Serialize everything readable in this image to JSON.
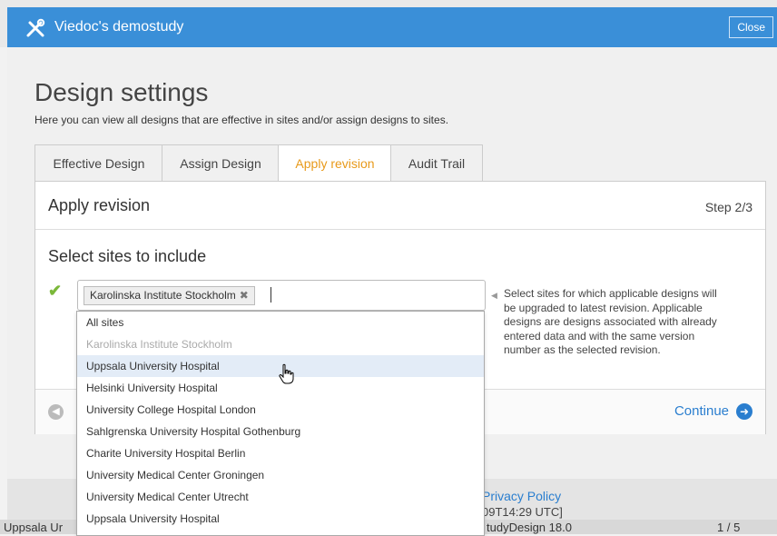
{
  "header": {
    "app_title": "Viedoc's demostudy",
    "close_label": "Close"
  },
  "page": {
    "title": "Design settings",
    "subtitle": "Here you can view all designs that are effective in sites and/or assign designs to sites."
  },
  "tabs": [
    {
      "label": "Effective Design"
    },
    {
      "label": "Assign Design"
    },
    {
      "label": "Apply revision"
    },
    {
      "label": "Audit Trail"
    }
  ],
  "active_tab": "Apply revision",
  "panel": {
    "heading": "Apply revision",
    "step": "Step 2/3",
    "section_title": "Select sites to include",
    "selected_chip": "Karolinska Institute Stockholm",
    "chip_remove": "✖",
    "help_text": "Select sites for which applicable designs will be upgraded to latest revision. Applicable designs are designs associated with already entered data and with the same version number as the selected revision.",
    "continue_label": "Continue"
  },
  "dropdown": {
    "options": [
      {
        "label": "All sites",
        "state": "normal"
      },
      {
        "label": "Karolinska Institute Stockholm",
        "state": "disabled"
      },
      {
        "label": "Uppsala University Hospital",
        "state": "hover"
      },
      {
        "label": "Helsinki University Hospital",
        "state": "normal"
      },
      {
        "label": "University College Hospital London",
        "state": "normal"
      },
      {
        "label": "Sahlgrenska University Hospital Gothenburg",
        "state": "normal"
      },
      {
        "label": "Charite University Hospital Berlin",
        "state": "normal"
      },
      {
        "label": "University Medical Center Groningen",
        "state": "normal"
      },
      {
        "label": "University Medical Center Utrecht",
        "state": "normal"
      },
      {
        "label": "Uppsala University Hospital",
        "state": "normal"
      }
    ]
  },
  "footer": {
    "privacy": "Privacy Policy",
    "timestamp": "09T14:29 UTC]"
  },
  "background_row": {
    "left": "Uppsala Ur",
    "middle": "tudyDesign 18.0",
    "right": "1 / 5"
  },
  "colors": {
    "header": "#3a8fd8",
    "active_tab": "#e89a1b",
    "link": "#2a7ecf",
    "check": "#7bb83a",
    "hover_row": "#e3ecf7"
  }
}
